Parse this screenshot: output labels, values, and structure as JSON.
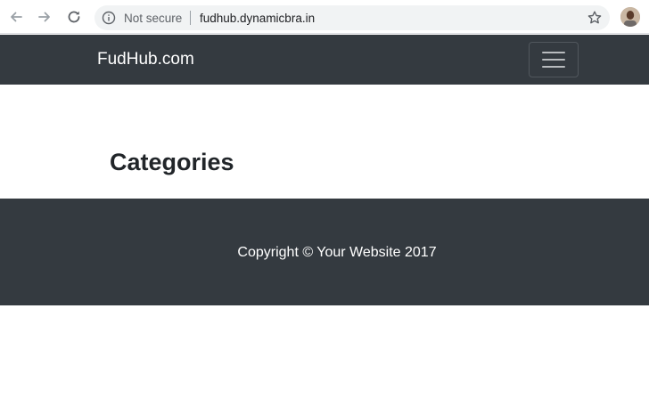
{
  "browser": {
    "security_label": "Not secure",
    "url": "fudhub.dynamicbra.in"
  },
  "navbar": {
    "brand": "FudHub.com"
  },
  "main": {
    "title": "Categories"
  },
  "footer": {
    "copyright": "Copyright © Your Website 2017"
  },
  "colors": {
    "navbar_bg": "#343a40",
    "footer_bg": "#343a40",
    "title_text": "#212529"
  }
}
